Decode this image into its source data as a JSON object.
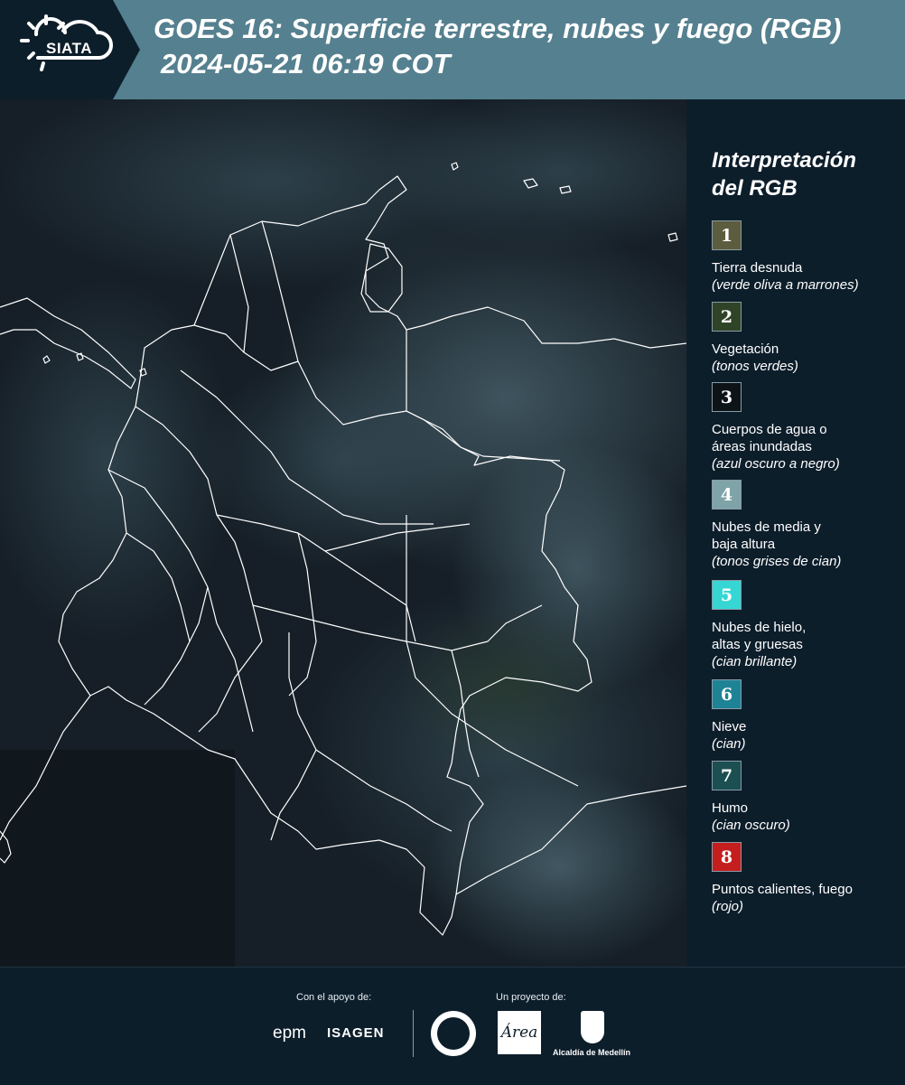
{
  "header": {
    "logo_text": "SIATA",
    "title_line1": "GOES 16: Superficie terrestre, nubes y fuego (RGB)",
    "title_line2": "2024-05-21 06:19 COT",
    "band_color": "#55808f",
    "logo_color": "#0d1e2b"
  },
  "map": {
    "description_icon": "satellite-rgb-composite",
    "border_color": "#ffffff"
  },
  "legend": {
    "title_line1": "Interpretación",
    "title_line2": "del RGB",
    "items": [
      {
        "num": "1",
        "color": "#5c5c3e",
        "label_lines": [
          "Tierra desnuda"
        ],
        "sub": "(verde oliva a marrones)"
      },
      {
        "num": "2",
        "color": "#2f4426",
        "label_lines": [
          "Vegetación"
        ],
        "sub": "(tonos verdes)"
      },
      {
        "num": "3",
        "color": "#0c1418",
        "label_lines": [
          "Cuerpos de agua o",
          "áreas inundadas"
        ],
        "sub": "(azul oscuro a negro)"
      },
      {
        "num": "4",
        "color": "#7fa4a7",
        "label_lines": [
          "Nubes de media y",
          "baja altura"
        ],
        "sub": "(tonos grises de cian)"
      },
      {
        "num": "5",
        "color": "#36d6d4",
        "label_lines": [
          "Nubes de hielo,",
          "altas y gruesas"
        ],
        "sub": "(cian brillante)"
      },
      {
        "num": "6",
        "color": "#1f8396",
        "label_lines": [
          "Nieve"
        ],
        "sub": "(cian)"
      },
      {
        "num": "7",
        "color": "#1c4f51",
        "label_lines": [
          "Humo"
        ],
        "sub": "(cian oscuro)"
      },
      {
        "num": "8",
        "color": "#c41e1e",
        "label_lines": [
          "Puntos calientes, fuego"
        ],
        "sub": "(rojo)"
      }
    ]
  },
  "footer": {
    "support_label": "Con el apoyo de:",
    "project_label": "Un proyecto de:",
    "epm": "epm",
    "isagen": "ISAGEN",
    "area_logo": "Área",
    "alcaldia": "Alcaldía de Medellín"
  }
}
